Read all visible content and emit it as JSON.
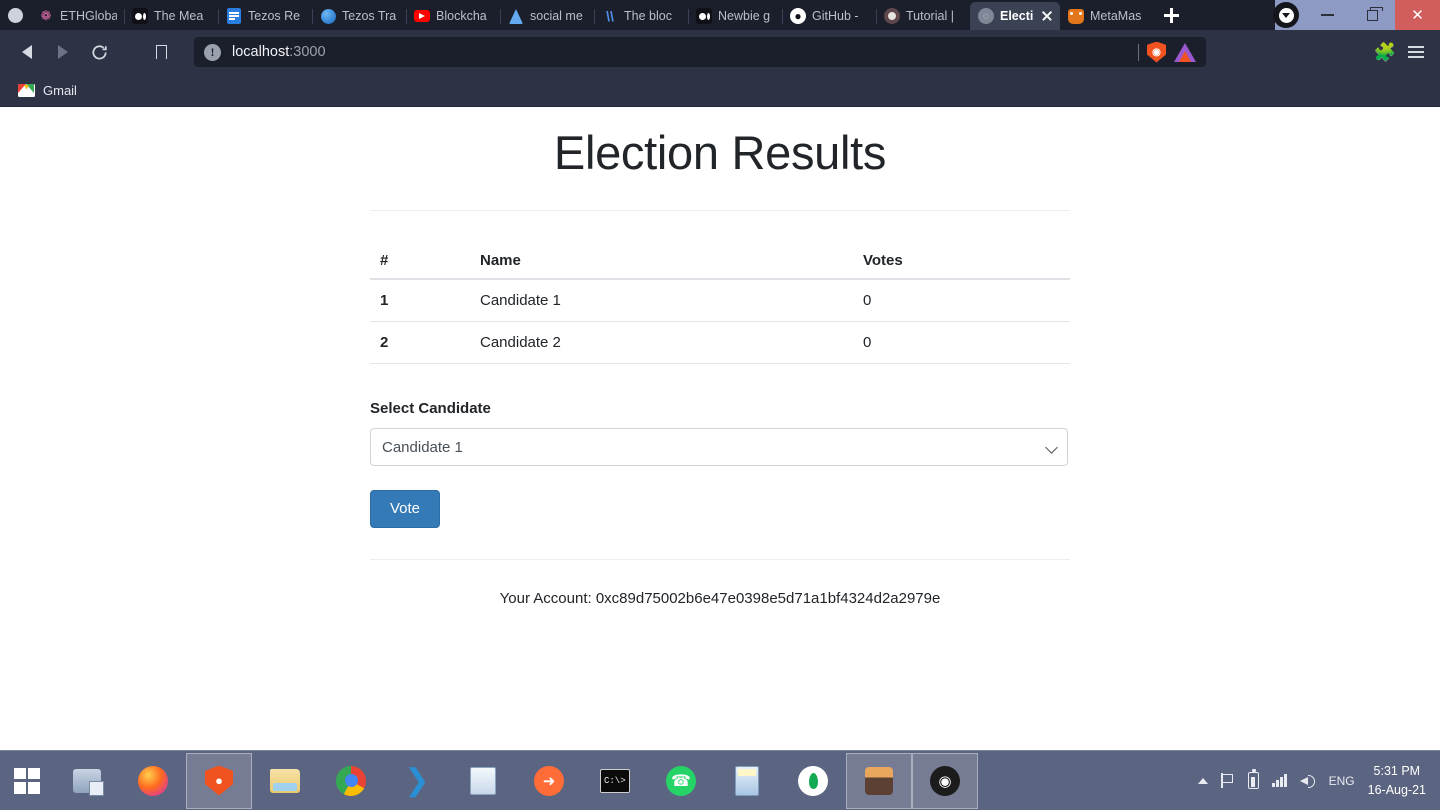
{
  "browser": {
    "name": "Brave",
    "tabs": [
      {
        "title": "ETHGloba",
        "icon": "ethglobal-icon",
        "active": false
      },
      {
        "title": "The Mea",
        "icon": "medium-icon",
        "active": false
      },
      {
        "title": "Tezos Re",
        "icon": "docs-icon",
        "active": false
      },
      {
        "title": "Tezos Tra",
        "icon": "globe-icon",
        "active": false
      },
      {
        "title": "Blockcha",
        "icon": "youtube-icon",
        "active": false
      },
      {
        "title": "social me",
        "icon": "ethereum-icon",
        "active": false
      },
      {
        "title": "The bloc",
        "icon": "steemit-icon",
        "active": false
      },
      {
        "title": "Newbie g",
        "icon": "medium-icon",
        "active": false
      },
      {
        "title": "GitHub -",
        "icon": "github-icon",
        "active": false
      },
      {
        "title": "Tutorial |",
        "icon": "truffle-icon",
        "active": false
      },
      {
        "title": "Electi",
        "icon": "react-icon",
        "active": true
      },
      {
        "title": "MetaMas",
        "icon": "metamask-icon",
        "active": false
      }
    ],
    "newtab_label": "+",
    "nav": {
      "back": "back-button",
      "forward": "forward-button",
      "reload": "reload-button",
      "bookmark": "bookmark-button"
    },
    "url": {
      "host": "localhost",
      "port": ":3000",
      "security_icon": "info-icon"
    },
    "toolbar_right": {
      "shield_label": "Brave Shields",
      "rewards_label": "Brave Rewards",
      "extensions_label": "Extensions",
      "menu_label": "Customize and control Brave"
    },
    "bookmarks": [
      {
        "label": "Gmail",
        "icon": "gmail-icon"
      }
    ],
    "window_controls": {
      "minimize": "–",
      "maximize": "❐",
      "close": "✕"
    }
  },
  "page": {
    "title": "Election Results",
    "table": {
      "headers": [
        "#",
        "Name",
        "Votes"
      ],
      "rows": [
        {
          "index": "1",
          "name": "Candidate 1",
          "votes": "0"
        },
        {
          "index": "2",
          "name": "Candidate 2",
          "votes": "0"
        }
      ]
    },
    "form": {
      "select_label": "Select Candidate",
      "select_value": "Candidate 1",
      "select_options": [
        "Candidate 1",
        "Candidate 2"
      ],
      "vote_button": "Vote"
    },
    "account_text": "Your Account: 0xc89d75002b6e47e0398e5d71a1bf4324d2a2979e",
    "accent_color": "#337ab7"
  },
  "taskbar": {
    "start_label": "Start",
    "items": [
      {
        "name": "scanner-app",
        "icon": "scanner-icon",
        "active": false
      },
      {
        "name": "firefox",
        "icon": "firefox-icon",
        "active": false
      },
      {
        "name": "brave-browser",
        "icon": "brave-lion-icon",
        "active": true
      },
      {
        "name": "file-explorer",
        "icon": "folder-icon",
        "active": false
      },
      {
        "name": "chrome",
        "icon": "chrome-icon",
        "active": false
      },
      {
        "name": "vs-code",
        "icon": "vscode-icon",
        "active": false
      },
      {
        "name": "notepad",
        "icon": "notepad-icon",
        "active": false
      },
      {
        "name": "postman",
        "icon": "postman-icon",
        "active": false
      },
      {
        "name": "command-prompt",
        "icon": "terminal-icon",
        "active": false
      },
      {
        "name": "whatsapp",
        "icon": "whatsapp-icon",
        "active": false
      },
      {
        "name": "calculator",
        "icon": "calculator-icon",
        "active": false
      },
      {
        "name": "mongodb",
        "icon": "mongodb-icon",
        "active": false
      },
      {
        "name": "ganache",
        "icon": "ganache-icon",
        "active": true
      },
      {
        "name": "obs-studio",
        "icon": "obs-icon",
        "active": true
      }
    ],
    "tray": {
      "language": "ENG",
      "time": "5:31 PM",
      "date": "16-Aug-21"
    }
  }
}
